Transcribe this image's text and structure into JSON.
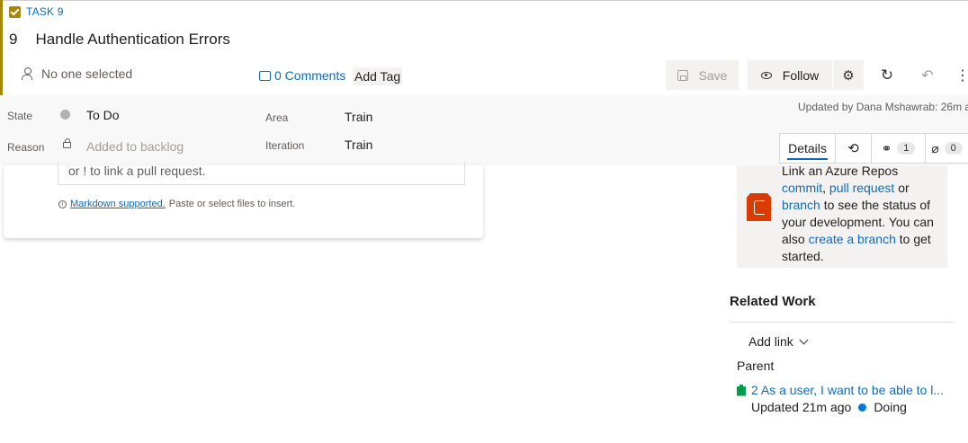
{
  "work_item": {
    "type_label": "TASK 9",
    "id": "9",
    "title": "Handle Authentication Errors"
  },
  "toolbar": {
    "assignee": "No one selected",
    "comments_label": "0 Comments",
    "add_tag_label": "Add Tag",
    "save_label": "Save",
    "follow_label": "Follow"
  },
  "fields": {
    "state_label": "State",
    "state_value": "To Do",
    "reason_label": "Reason",
    "reason_value": "Added to backlog",
    "area_label": "Area",
    "area_value": "Train",
    "iteration_label": "Iteration",
    "iteration_value": "Train"
  },
  "updated_by": "Updated by Dana Mshawrab: 26m a",
  "tabs": {
    "details_label": "Details",
    "links_count": "1",
    "attachments_count": "0"
  },
  "discussion": {
    "editor_hint": "or ! to link a pull request.",
    "markdown_link": "Markdown supported.",
    "markdown_hint": "Paste or select files to insert."
  },
  "development": {
    "line1": "Link an Azure Repos",
    "commit": "commit",
    "pull_request": "pull request",
    "or": "or",
    "branch": "branch",
    "rest": "to see the status of your development. You can also",
    "create_branch": "create a branch",
    "tail": "to get started."
  },
  "related_work": {
    "title": "Related Work",
    "add_link": "Add link",
    "parent_label": "Parent",
    "parent_item": "2 As a user, I want to be able to l...",
    "parent_updated": "Updated 21m ago",
    "parent_state": "Doing"
  },
  "colors": {
    "task_accent": "#a4880a",
    "link_blue": "#0f6cbd",
    "doing_blue": "#0078d4",
    "story_green": "#009b4d",
    "repo_orange": "#da3b01"
  }
}
